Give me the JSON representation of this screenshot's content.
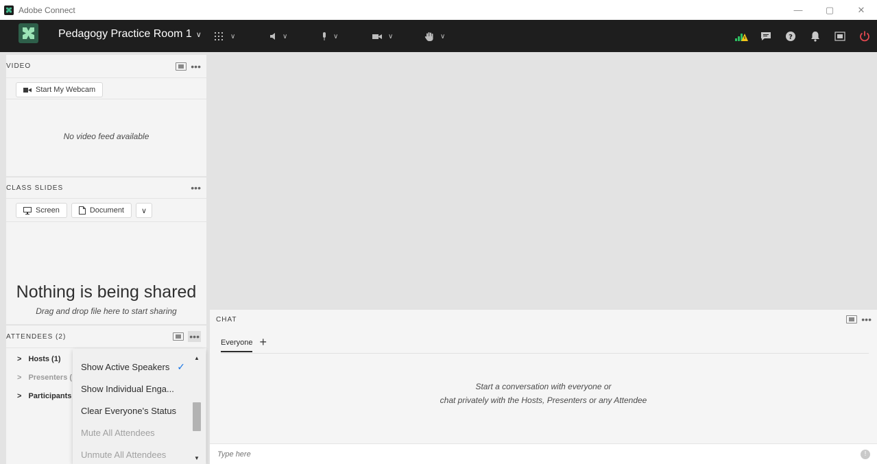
{
  "window": {
    "title": "Adobe Connect",
    "controls": [
      "—",
      "▢",
      "✕"
    ]
  },
  "appbar": {
    "room_name": "Pedagogy Practice Room 1",
    "tools": [
      {
        "icon": "apps-grid-icon"
      },
      {
        "icon": "speaker-icon"
      },
      {
        "icon": "microphone-icon"
      },
      {
        "icon": "camera-icon"
      },
      {
        "icon": "raise-hand-icon"
      }
    ],
    "right_icons": [
      "signal-strength-icon",
      "chat-bubble-icon",
      "help-icon",
      "notification-bell-icon",
      "fullscreen-icon",
      "power-icon"
    ],
    "colors": {
      "power": "#e34850",
      "signal_green": "#2dbf62",
      "signal_warning": "#f5c518"
    }
  },
  "video": {
    "title": "VIDEO",
    "start_webcam": "Start My Webcam",
    "no_feed": "No video feed available"
  },
  "class_slides": {
    "title": "CLASS SLIDES",
    "screen_btn": "Screen",
    "document_btn": "Document",
    "nothing_shared": "Nothing is being shared",
    "drag_drop": "Drag and drop file here to start sharing"
  },
  "attendees": {
    "title": "ATTENDEES (2)",
    "groups": [
      {
        "label": "Hosts (1)",
        "dim": false
      },
      {
        "label": "Presenters (",
        "dim": true
      },
      {
        "label": "Participants",
        "dim": false
      }
    ]
  },
  "menu": {
    "items": [
      {
        "label": "Show Active Speakers",
        "checked": true,
        "disabled": false
      },
      {
        "label": "Show Individual Enga...",
        "checked": false,
        "disabled": false
      },
      {
        "label": "Clear Everyone's Status",
        "checked": false,
        "disabled": false
      },
      {
        "label": "Mute All Attendees",
        "checked": false,
        "disabled": true
      },
      {
        "label": "Unmute All Attendees",
        "checked": false,
        "disabled": true
      }
    ]
  },
  "chat": {
    "title": "CHAT",
    "tab": "Everyone",
    "empty_line1": "Start a conversation with everyone or",
    "empty_line2": "chat privately with the Hosts, Presenters or any Attendee",
    "input_placeholder": "Type here"
  }
}
